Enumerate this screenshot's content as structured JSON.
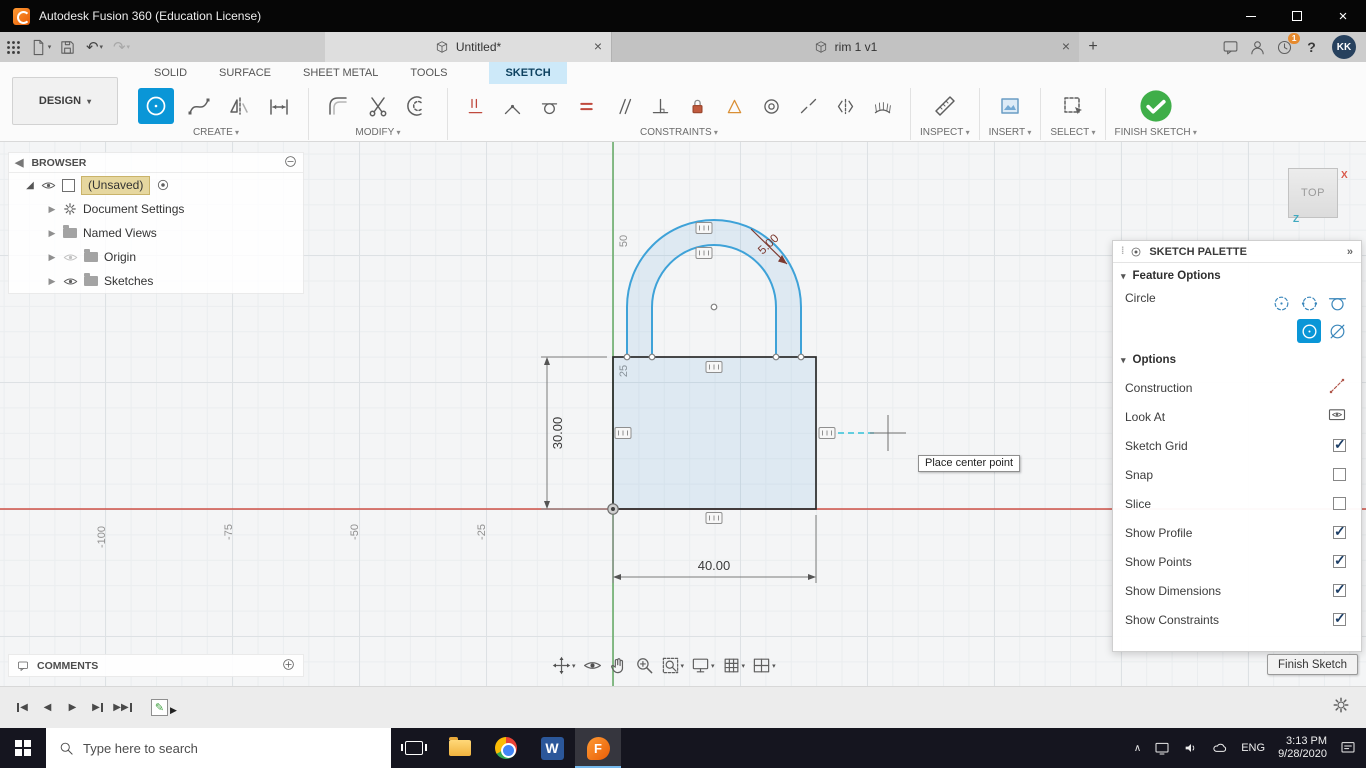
{
  "titlebar": {
    "title": "Autodesk Fusion 360 (Education License)"
  },
  "tabbar": {
    "tabs": [
      {
        "label": "Untitled*"
      },
      {
        "label": "rim 1 v1"
      }
    ],
    "notification_badge": "1",
    "avatar_initials": "KK",
    "help_glyph": "?"
  },
  "ribbon": {
    "workspace": "DESIGN",
    "tabs": [
      "SOLID",
      "SURFACE",
      "SHEET METAL",
      "TOOLS",
      "SKETCH"
    ],
    "active_tab": "SKETCH",
    "groups": [
      {
        "label": "CREATE"
      },
      {
        "label": "MODIFY"
      },
      {
        "label": "CONSTRAINTS"
      },
      {
        "label": "INSPECT"
      },
      {
        "label": "INSERT"
      },
      {
        "label": "SELECT"
      },
      {
        "label": "FINISH SKETCH"
      }
    ]
  },
  "browser": {
    "title": "BROWSER",
    "root_label": "(Unsaved)",
    "items": [
      {
        "label": "Document Settings"
      },
      {
        "label": "Named Views"
      },
      {
        "label": "Origin"
      },
      {
        "label": "Sketches"
      }
    ],
    "comments_label": "COMMENTS"
  },
  "canvas": {
    "viewcube_face": "TOP",
    "viewcube_axes": {
      "x": "X",
      "z": "Z"
    },
    "dimensions": {
      "height": "30.00",
      "width": "40.00",
      "arc_offset": "5.00"
    },
    "axis_labels_x": [
      "-100",
      "-75",
      "-50",
      "-25"
    ],
    "axis_labels_y": [
      "50",
      "25"
    ],
    "tooltip": "Place center point"
  },
  "palette": {
    "title": "SKETCH PALETTE",
    "sections": {
      "feature_options": "Feature Options",
      "options": "Options"
    },
    "feature_label": "Circle",
    "options": [
      {
        "label": "Construction"
      },
      {
        "label": "Look At"
      },
      {
        "label": "Sketch Grid",
        "checked": true
      },
      {
        "label": "Snap",
        "checked": false
      },
      {
        "label": "Slice",
        "checked": false
      },
      {
        "label": "Show Profile",
        "checked": true
      },
      {
        "label": "Show Points",
        "checked": true
      },
      {
        "label": "Show Dimensions",
        "checked": true
      },
      {
        "label": "Show Constraints",
        "checked": true
      }
    ],
    "finish_button": "Finish Sketch"
  },
  "taskbar": {
    "search_placeholder": "Type here to search",
    "language": "ENG",
    "time": "3:13 PM",
    "date": "9/28/2020"
  },
  "colors": {
    "accent_blue": "#0a96d7",
    "finish_green": "#3fae49",
    "x_axis_red": "#cf5146",
    "y_axis_green": "#61a861",
    "sketch_blue": "#3ea2d8",
    "selection_gold": "#e6d79f"
  }
}
